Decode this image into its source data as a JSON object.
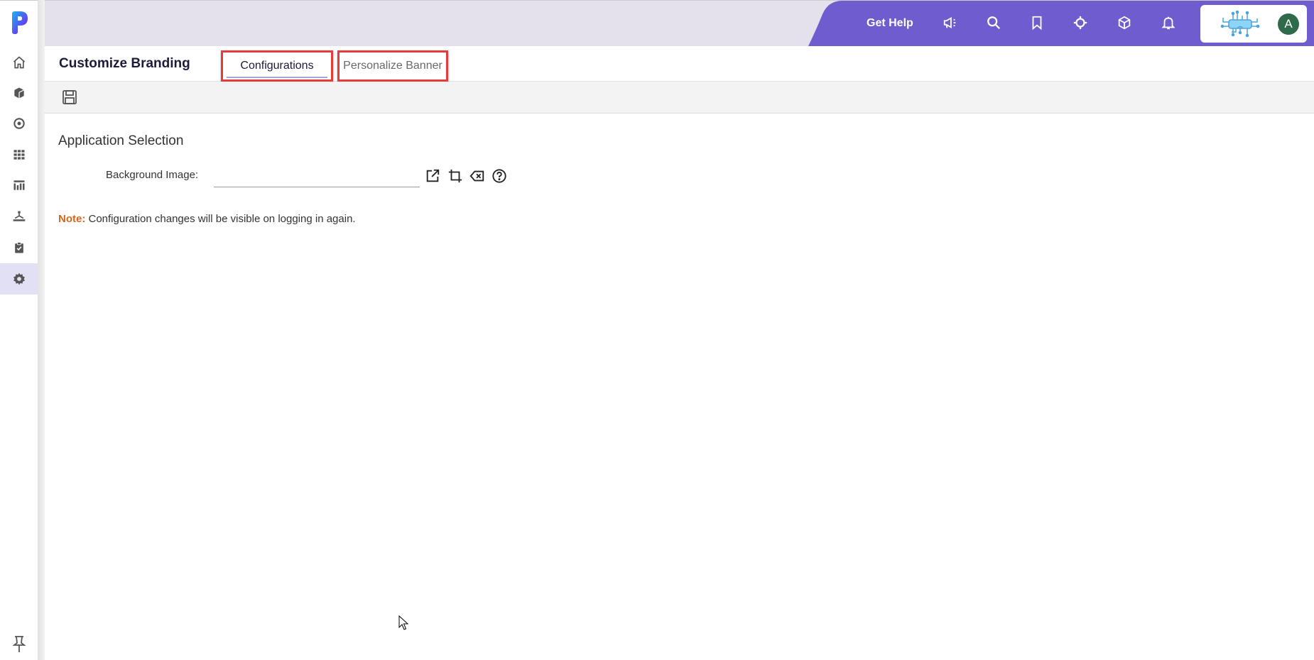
{
  "sidebar": {
    "logo": "p-logo-icon",
    "items": [
      {
        "name": "home",
        "icon": "home-icon",
        "active": false
      },
      {
        "name": "objects",
        "icon": "cube-icon",
        "active": false
      },
      {
        "name": "target",
        "icon": "target-icon",
        "active": false
      },
      {
        "name": "grid",
        "icon": "grid-icon",
        "active": false
      },
      {
        "name": "reports",
        "icon": "report-icon",
        "active": false
      },
      {
        "name": "hierarchy",
        "icon": "hierarchy-icon",
        "active": false
      },
      {
        "name": "tasks",
        "icon": "clipboard-check-icon",
        "active": false
      },
      {
        "name": "settings",
        "icon": "gear-icon",
        "active": true
      }
    ],
    "pin": "pin-icon"
  },
  "topbar": {
    "get_help": "Get Help",
    "icons": [
      "megaphone-icon",
      "search-icon",
      "bookmark-icon",
      "crosshair-icon",
      "box-icon",
      "bell-icon"
    ],
    "avatar_initial": "A",
    "accent": "#6f5ccf"
  },
  "page": {
    "title": "Customize Branding",
    "tabs": [
      {
        "label": "Configurations",
        "active": true
      },
      {
        "label": "Personalize Banner",
        "active": false
      }
    ]
  },
  "toolbar": {
    "save": "save-icon"
  },
  "content": {
    "section_title": "Application Selection",
    "background_image_label": "Background Image:",
    "background_image_value": "",
    "field_actions": [
      "open-external-icon",
      "crop-icon",
      "clear-icon",
      "help-icon"
    ],
    "note_label": "Note:",
    "note_text": " Configuration changes will be visible on logging in again."
  }
}
